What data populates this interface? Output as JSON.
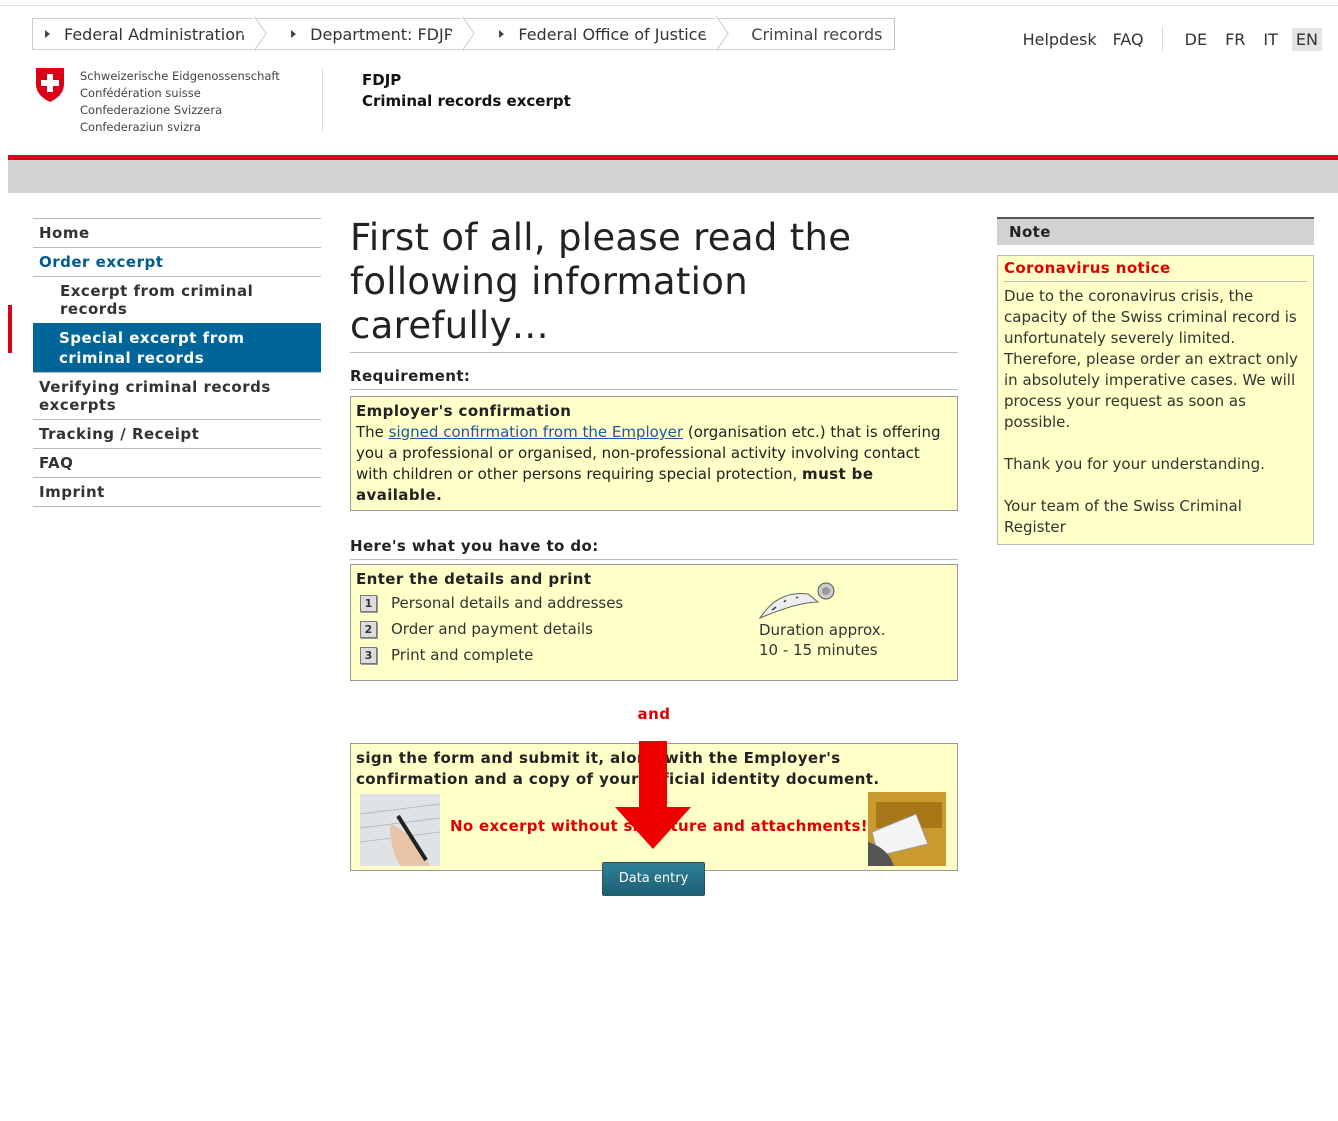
{
  "breadcrumb": [
    {
      "label": "Federal Administration"
    },
    {
      "label": "Department: FDJP"
    },
    {
      "label": "Federal Office of Justice"
    },
    {
      "label": "Criminal records"
    }
  ],
  "toplinks": {
    "helpdesk": "Helpdesk",
    "faq": "FAQ"
  },
  "languages": [
    "DE",
    "FR",
    "IT",
    "EN"
  ],
  "active_language": "EN",
  "confederation": {
    "line1": "Schweizerische Eidgenossenschaft",
    "line2": "Confédération suisse",
    "line3": "Confederazione Svizzera",
    "line4": "Confederaziun svizra"
  },
  "department": {
    "abbr": "FDJP",
    "title": "Criminal records excerpt"
  },
  "nav": {
    "home": "Home",
    "order_excerpt": "Order excerpt",
    "excerpt_criminal": "Excerpt from criminal records",
    "special_excerpt": "Special excerpt from criminal records",
    "verifying": "Verifying criminal records excerpts",
    "tracking": "Tracking / Receipt",
    "faq": "FAQ",
    "imprint": "Imprint"
  },
  "main": {
    "heading": "First of all, please read the following information carefully…",
    "requirement_title": "Requirement:",
    "employer_title": "Employer's confirmation",
    "employer_pre": "The ",
    "employer_link": "signed confirmation from the Employer",
    "employer_post": " (organisation etc.) that is offering you a professional or organised, non-professional activity involving contact with children or other persons requiring special protection, ",
    "employer_bold": "must be available.",
    "todo_title": "Here's what you have to do:",
    "details_title": "Enter the details and print",
    "steps": [
      {
        "num": "1",
        "label": "Personal details and addresses"
      },
      {
        "num": "2",
        "label": "Order and payment details"
      },
      {
        "num": "3",
        "label": "Print and complete"
      }
    ],
    "duration_line1": "Duration approx.",
    "duration_line2": "10 - 15 minutes",
    "and_text": "and",
    "sign_text": "sign the form and submit it, along with the Employer's confirmation and a copy of your official identity document.",
    "warning": "No excerpt without signature and attachments!",
    "button": "Data entry"
  },
  "note": {
    "header": "Note",
    "title": "Coronavirus notice",
    "p1": "Due to the coronavirus crisis, the capacity of the Swiss criminal record is unfortunately severely limited. Therefore, please order an extract only in absolutely imperative cases. We will process your request as soon as possible.",
    "p2": "Thank you for your understanding.",
    "p3": "Your team of the Swiss Criminal Register"
  },
  "colors": {
    "swiss_red": "#dc0018",
    "nav_active": "#006699",
    "yellow_box": "#ffffc8",
    "warning_red": "#e00000",
    "button": "#1d6076"
  }
}
